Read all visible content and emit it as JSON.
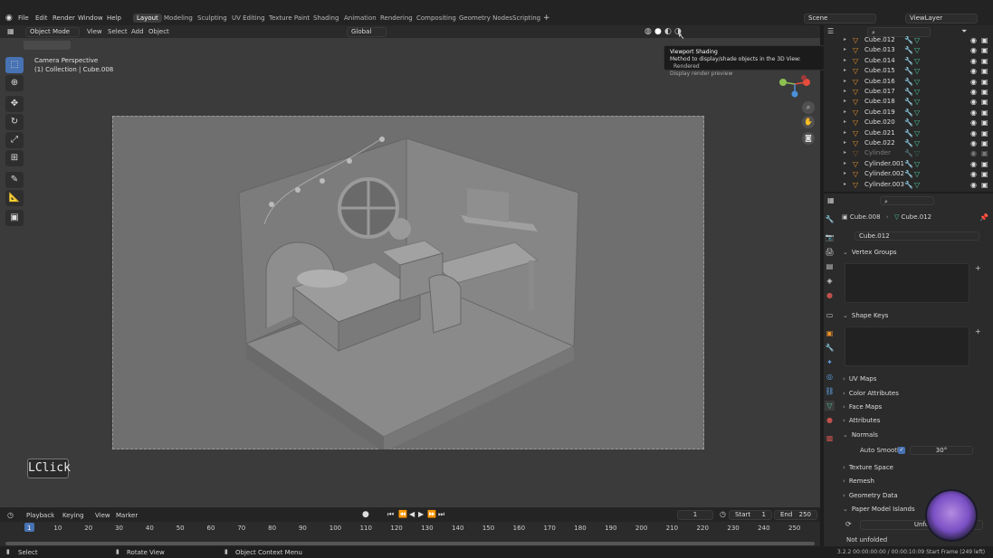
{
  "menus": [
    "File",
    "Edit",
    "Render",
    "Window",
    "Help"
  ],
  "workspaces": [
    "Layout",
    "Modeling",
    "Sculpting",
    "UV Editing",
    "Texture Paint",
    "Shading",
    "Animation",
    "Rendering",
    "Compositing",
    "Geometry Nodes",
    "Scripting"
  ],
  "active_workspace": "Layout",
  "scene": "Scene",
  "view_layer": "ViewLayer",
  "viewport_header": {
    "mode": "Object Mode",
    "menus": [
      "View",
      "Select",
      "Add",
      "Object"
    ],
    "orientation": "Global"
  },
  "viewport": {
    "perspective": "Camera Perspective",
    "collection": "(1) Collection | Cube.008",
    "key_hint": "LClick"
  },
  "tooltip": {
    "title": "Viewport Shading",
    "description": "Method to display/shade objects in the 3D View:",
    "value": "Rendered",
    "detail": "Display render preview"
  },
  "outliner": [
    {
      "name": "Cube.012"
    },
    {
      "name": "Cube.013"
    },
    {
      "name": "Cube.014"
    },
    {
      "name": "Cube.015"
    },
    {
      "name": "Cube.016"
    },
    {
      "name": "Cube.017"
    },
    {
      "name": "Cube.018"
    },
    {
      "name": "Cube.019"
    },
    {
      "name": "Cube.020"
    },
    {
      "name": "Cube.021"
    },
    {
      "name": "Cube.022"
    },
    {
      "name": "Cylinder"
    },
    {
      "name": "Cylinder.001"
    },
    {
      "name": "Cylinder.002"
    },
    {
      "name": "Cylinder.003"
    }
  ],
  "properties": {
    "breadcrumb_object": "Cube.008",
    "breadcrumb_mesh": "Cube.012",
    "mesh_name": "Cube.012",
    "sections": {
      "vertex_groups": "Vertex Groups",
      "shape_keys": "Shape Keys",
      "uv_maps": "UV Maps",
      "color_attributes": "Color Attributes",
      "face_maps": "Face Maps",
      "attributes": "Attributes",
      "normals": "Normals",
      "texture_space": "Texture Space",
      "remesh": "Remesh",
      "geometry_data": "Geometry Data",
      "paper_model": "Paper Model Islands"
    },
    "auto_smooth_label": "Auto Smooth",
    "auto_smooth_angle": "30°",
    "unfold_label": "Unfo",
    "not_unfolded": "Not unfolded"
  },
  "timeline": {
    "menus": [
      "Playback",
      "Keying",
      "View",
      "Marker"
    ],
    "current_frame": "1",
    "start_label": "Start",
    "start": "1",
    "end_label": "End",
    "end": "250",
    "ticks": [
      "1",
      "10",
      "20",
      "30",
      "40",
      "50",
      "60",
      "70",
      "80",
      "90",
      "100",
      "110",
      "120",
      "130",
      "140",
      "150",
      "160",
      "170",
      "180",
      "190",
      "200",
      "210",
      "220",
      "230",
      "240",
      "250"
    ]
  },
  "statusbar": {
    "select": "Select",
    "rotate": "Rotate View",
    "context": "Object Context Menu",
    "info": "3.2.2  00:00:00:00 / 00:00:10:09  Start Frame (249 left)"
  },
  "colors": {
    "accent": "#4772b3",
    "object_icon": "#e8922b",
    "mesh_icon": "#4dc7a0"
  }
}
